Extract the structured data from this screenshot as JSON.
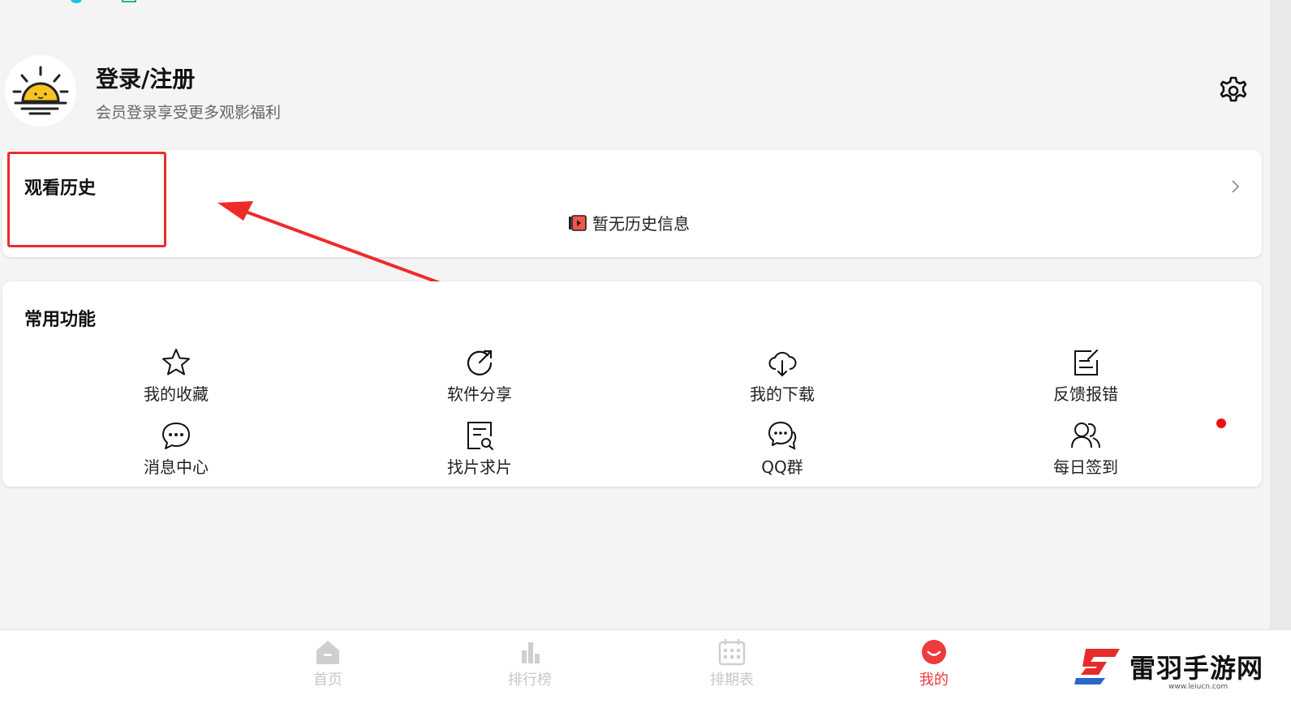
{
  "profile": {
    "title": "登录/注册",
    "subtitle": "会员登录享受更多观影福利"
  },
  "history": {
    "title": "观看历史",
    "empty_text": "暂无历史信息"
  },
  "functions": {
    "title": "常用功能",
    "items": [
      {
        "label": "我的收藏",
        "icon": "star-icon"
      },
      {
        "label": "软件分享",
        "icon": "share-icon"
      },
      {
        "label": "我的下载",
        "icon": "cloud-download-icon"
      },
      {
        "label": "反馈报错",
        "icon": "edit-note-icon"
      },
      {
        "label": "消息中心",
        "icon": "chat-bubble-icon"
      },
      {
        "label": "找片求片",
        "icon": "search-document-icon"
      },
      {
        "label": "QQ群",
        "icon": "group-chat-icon"
      },
      {
        "label": "每日签到",
        "icon": "users-icon"
      }
    ]
  },
  "bottom_nav": {
    "items": [
      {
        "label": "首页",
        "icon": "home-icon",
        "active": false
      },
      {
        "label": "排行榜",
        "icon": "bar-chart-icon",
        "active": false
      },
      {
        "label": "排期表",
        "icon": "calendar-icon",
        "active": false
      },
      {
        "label": "我的",
        "icon": "smile-icon",
        "active": true
      }
    ]
  },
  "watermark": {
    "text": "雷羽手游网",
    "url": "www.leiucn.com"
  },
  "colors": {
    "accent": "#ee3b3b",
    "highlight": "#ee2b2b",
    "inactive": "#c8c8c8"
  }
}
